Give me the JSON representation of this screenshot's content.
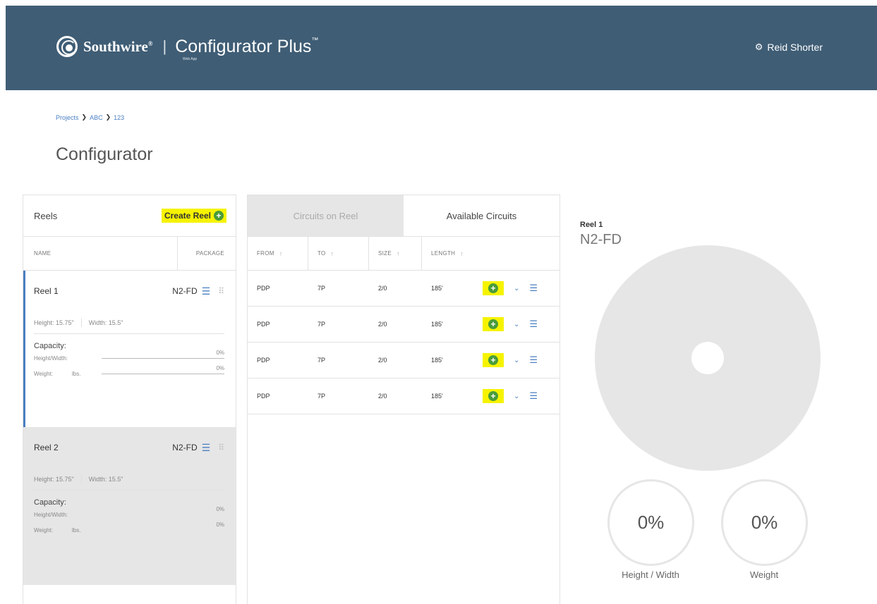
{
  "header": {
    "brand": "Southwire",
    "brand_reg": "®",
    "separator": "|",
    "app_title": "Configurator Plus",
    "app_tm": "™",
    "app_sub": "Web App",
    "user_icon": "gear-icon",
    "user_name": "Reid Shorter",
    "bg_color": "#3f5d75"
  },
  "breadcrumb": [
    "Projects",
    "ABC",
    "123"
  ],
  "page_title": "Configurator",
  "reels_panel": {
    "title": "Reels",
    "create_label": "Create Reel",
    "columns": {
      "name": "NAME",
      "package": "PACKAGE"
    },
    "reels": [
      {
        "name": "Reel 1",
        "package": "N2-FD",
        "height": "Height: 15.75\"",
        "width": "Width: 15.5\"",
        "capacity_title": "Capacity:",
        "hw_label": "Height/Width:",
        "hw_pct": "0%",
        "weight_label": "Weight:",
        "weight_unit": "lbs.",
        "weight_pct": "0%"
      },
      {
        "name": "Reel 2",
        "package": "N2-FD",
        "height": "Height: 15.75\"",
        "width": "Width: 15.5\"",
        "capacity_title": "Capacity:",
        "hw_label": "Height/Width:",
        "hw_pct": "0%",
        "weight_label": "Weight:",
        "weight_unit": "lbs.",
        "weight_pct": "0%"
      }
    ]
  },
  "circuits_panel": {
    "tabs": [
      "Circuits on Reel",
      "Available Circuits"
    ],
    "columns": [
      "FROM",
      "TO",
      "SIZE",
      "LENGTH"
    ],
    "rows": [
      {
        "from": "PDP",
        "to": "7P",
        "size": "2/0",
        "length": "185'"
      },
      {
        "from": "PDP",
        "to": "7P",
        "size": "2/0",
        "length": "185'"
      },
      {
        "from": "PDP",
        "to": "7P",
        "size": "2/0",
        "length": "185'"
      },
      {
        "from": "PDP",
        "to": "7P",
        "size": "2/0",
        "length": "185'"
      }
    ]
  },
  "visual": {
    "reel_label": "Reel 1",
    "package": "N2-FD",
    "gauges": [
      {
        "value": "0%",
        "label": "Height / Width"
      },
      {
        "value": "0%",
        "label": "Weight"
      }
    ]
  },
  "colors": {
    "accent": "#4a7fc2",
    "highlight": "#f6f300",
    "add_green": "#4a9c3a",
    "panel_gray": "#e6e6e7"
  }
}
